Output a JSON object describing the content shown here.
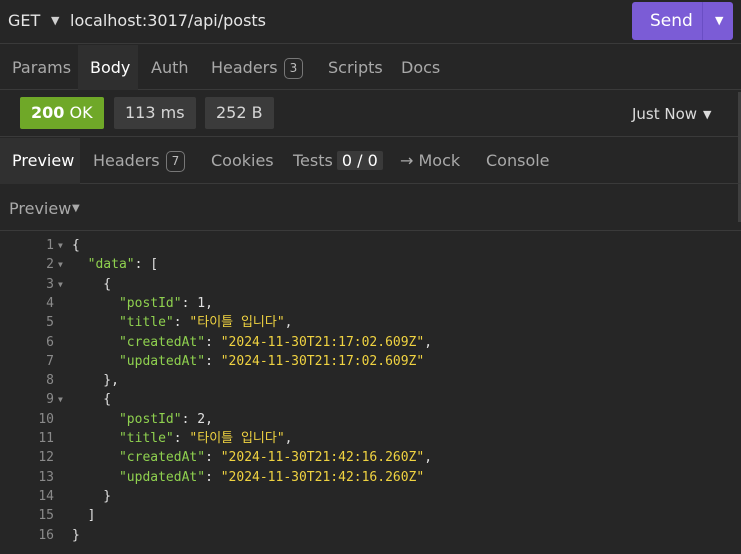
{
  "request": {
    "method": "GET",
    "url": "localhost:3017/api/posts",
    "send_label": "Send"
  },
  "request_tabs": [
    {
      "label": "Params"
    },
    {
      "label": "Body",
      "active": true
    },
    {
      "label": "Auth"
    },
    {
      "label": "Headers",
      "badge": "3"
    },
    {
      "label": "Scripts"
    },
    {
      "label": "Docs"
    }
  ],
  "status": {
    "code": "200",
    "text": "OK",
    "time": "113 ms",
    "size": "252 B",
    "timestamp": "Just Now",
    "code_color": "#6fa828"
  },
  "response_tabs": [
    {
      "label": "Preview",
      "active": true
    },
    {
      "label": "Headers",
      "badge": "7"
    },
    {
      "label": "Cookies"
    },
    {
      "label": "Tests",
      "count": "0 / 0"
    },
    {
      "label": "→ Mock"
    },
    {
      "label": "Console"
    }
  ],
  "preview_mode": "Preview",
  "code_lines": [
    {
      "n": "1",
      "parts": [
        [
          "p",
          "{"
        ]
      ]
    },
    {
      "n": "2",
      "parts": [
        [
          "p",
          "  "
        ],
        [
          "k",
          "\"data\""
        ],
        [
          "p",
          ": ["
        ]
      ]
    },
    {
      "n": "3",
      "parts": [
        [
          "p",
          "    {"
        ]
      ]
    },
    {
      "n": "4",
      "parts": [
        [
          "p",
          "      "
        ],
        [
          "k",
          "\"postId\""
        ],
        [
          "p",
          ": "
        ],
        [
          "n",
          "1"
        ],
        [
          "p",
          ","
        ]
      ]
    },
    {
      "n": "5",
      "parts": [
        [
          "p",
          "      "
        ],
        [
          "k",
          "\"title\""
        ],
        [
          "p",
          ": "
        ],
        [
          "s",
          "\"타이틀 입니다\""
        ],
        [
          "p",
          ","
        ]
      ]
    },
    {
      "n": "6",
      "parts": [
        [
          "p",
          "      "
        ],
        [
          "k",
          "\"createdAt\""
        ],
        [
          "p",
          ": "
        ],
        [
          "s",
          "\"2024-11-30T21:17:02.609Z\""
        ],
        [
          "p",
          ","
        ]
      ]
    },
    {
      "n": "7",
      "parts": [
        [
          "p",
          "      "
        ],
        [
          "k",
          "\"updatedAt\""
        ],
        [
          "p",
          ": "
        ],
        [
          "s",
          "\"2024-11-30T21:17:02.609Z\""
        ]
      ]
    },
    {
      "n": "8",
      "parts": [
        [
          "p",
          "    },"
        ]
      ]
    },
    {
      "n": "9",
      "parts": [
        [
          "p",
          "    {"
        ]
      ]
    },
    {
      "n": "10",
      "parts": [
        [
          "p",
          "      "
        ],
        [
          "k",
          "\"postId\""
        ],
        [
          "p",
          ": "
        ],
        [
          "n",
          "2"
        ],
        [
          "p",
          ","
        ]
      ]
    },
    {
      "n": "11",
      "parts": [
        [
          "p",
          "      "
        ],
        [
          "k",
          "\"title\""
        ],
        [
          "p",
          ": "
        ],
        [
          "s",
          "\"타이틀 입니다\""
        ],
        [
          "p",
          ","
        ]
      ]
    },
    {
      "n": "12",
      "parts": [
        [
          "p",
          "      "
        ],
        [
          "k",
          "\"createdAt\""
        ],
        [
          "p",
          ": "
        ],
        [
          "s",
          "\"2024-11-30T21:42:16.260Z\""
        ],
        [
          "p",
          ","
        ]
      ]
    },
    {
      "n": "13",
      "parts": [
        [
          "p",
          "      "
        ],
        [
          "k",
          "\"updatedAt\""
        ],
        [
          "p",
          ": "
        ],
        [
          "s",
          "\"2024-11-30T21:42:16.260Z\""
        ]
      ]
    },
    {
      "n": "14",
      "parts": [
        [
          "p",
          "    }"
        ]
      ]
    },
    {
      "n": "15",
      "parts": [
        [
          "p",
          "  ]"
        ]
      ]
    },
    {
      "n": "16",
      "parts": [
        [
          "p",
          "}"
        ]
      ]
    }
  ],
  "foldable_lines": [
    "1",
    "2",
    "3",
    "9"
  ],
  "colors": {
    "accent": "#7b5cd6",
    "json_key": "#8fd14f",
    "json_string": "#f0d341"
  }
}
